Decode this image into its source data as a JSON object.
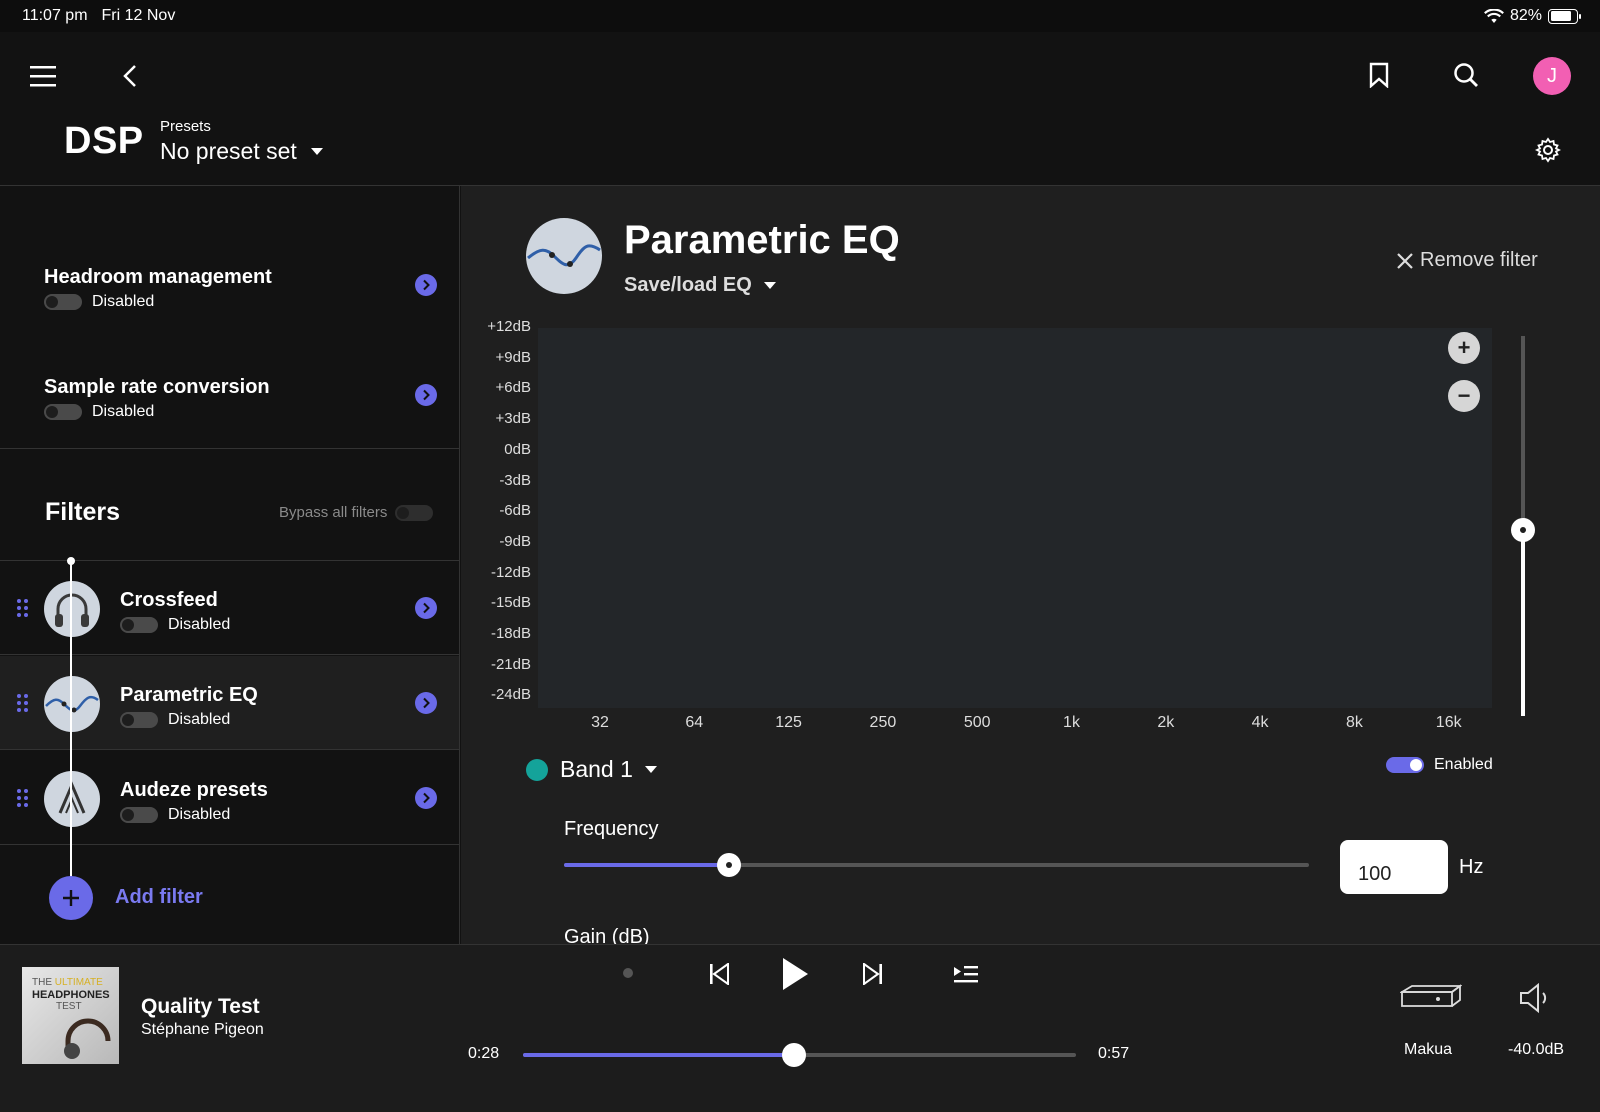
{
  "status": {
    "time": "11:07 pm",
    "date": "Fri 12 Nov",
    "battery": "82%",
    "battery_level": 0.82
  },
  "header": {
    "title": "DSP",
    "presets_label": "Presets",
    "preset_value": "No preset set"
  },
  "sidebar": {
    "items": [
      {
        "title": "Headroom management",
        "status": "Disabled"
      },
      {
        "title": "Sample rate conversion",
        "status": "Disabled"
      }
    ],
    "filters_title": "Filters",
    "bypass_label": "Bypass all filters",
    "filters": [
      {
        "title": "Crossfeed",
        "status": "Disabled",
        "icon": "headphones-icon"
      },
      {
        "title": "Parametric EQ",
        "status": "Disabled",
        "icon": "eq-curve-icon"
      },
      {
        "title": "Audeze presets",
        "status": "Disabled",
        "icon": "audeze-logo-icon"
      }
    ],
    "add_filter_label": "Add filter"
  },
  "main": {
    "title": "Parametric EQ",
    "save_load_label": "Save/load EQ",
    "remove_label": "Remove filter",
    "y_labels": [
      "+12dB",
      "+9dB",
      "+6dB",
      "+3dB",
      "0dB",
      "-3dB",
      "-6dB",
      "-9dB",
      "-12dB",
      "-15dB",
      "-18dB",
      "-21dB",
      "-24dB"
    ],
    "x_labels": [
      "32",
      "64",
      "125",
      "250",
      "500",
      "1k",
      "2k",
      "4k",
      "8k",
      "16k"
    ],
    "zoom_in": "+",
    "zoom_out": "−",
    "band_label": "Band 1",
    "band_color": "#14a39a",
    "enabled_label": "Enabled",
    "frequency_label": "Frequency",
    "frequency_value": "100",
    "frequency_unit": "Hz",
    "gain_label": "Gain (dB)"
  },
  "player": {
    "album_line1_a": "THE ",
    "album_line1_b": "ULTIMATE",
    "album_line2": "HEADPHONES",
    "album_line3": "TEST",
    "title": "Quality Test",
    "artist": "Stéphane Pigeon",
    "current_time": "0:28",
    "total_time": "0:57",
    "progress": 0.49,
    "device": "Makua",
    "volume": "-40.0dB"
  },
  "accent_color": "#6a6ae8"
}
